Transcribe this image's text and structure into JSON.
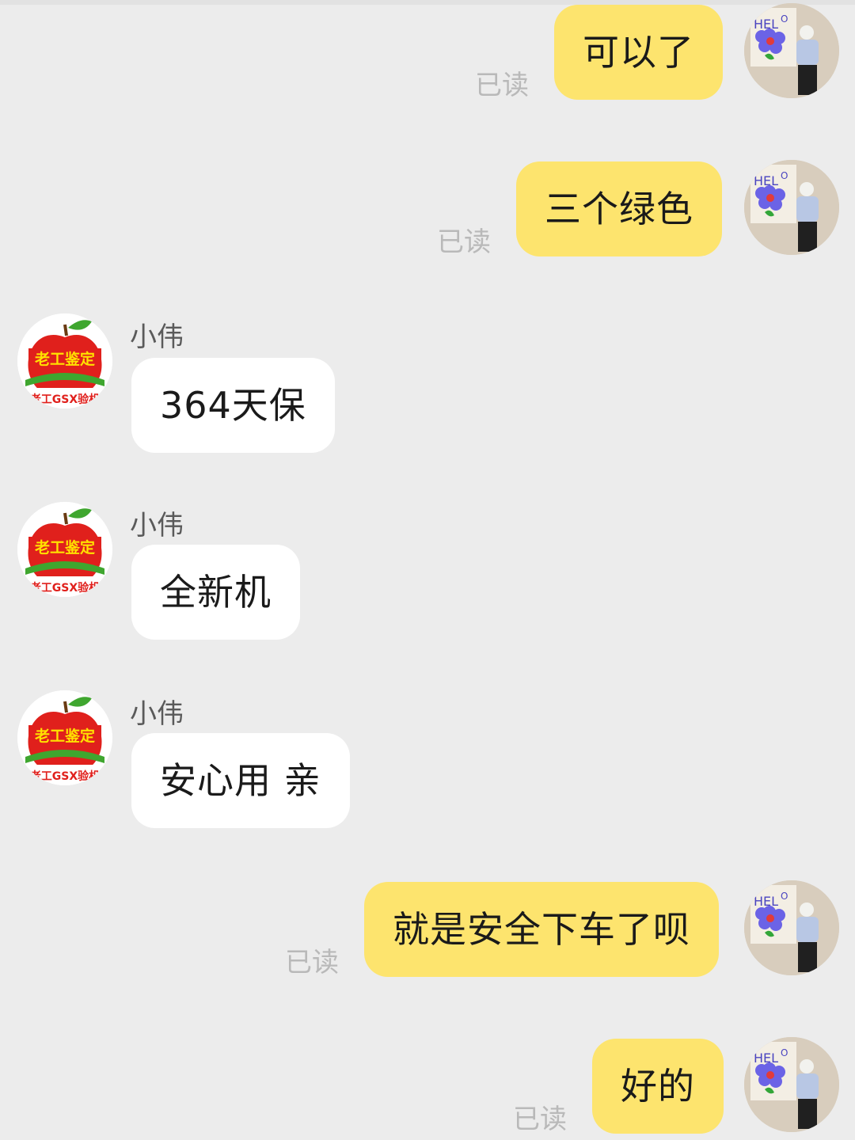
{
  "conversation": {
    "read_label": "已读",
    "messages": [
      {
        "id": "m1",
        "direction": "outgoing",
        "text": "可以了",
        "status": "已读"
      },
      {
        "id": "m2",
        "direction": "outgoing",
        "text": "三个绿色",
        "status": "已读"
      },
      {
        "id": "m3",
        "direction": "incoming",
        "sender": "小伟",
        "text": "364天保"
      },
      {
        "id": "m4",
        "direction": "incoming",
        "sender": "小伟",
        "text": "全新机"
      },
      {
        "id": "m5",
        "direction": "incoming",
        "sender": "小伟",
        "text": "安心用 亲"
      },
      {
        "id": "m6",
        "direction": "outgoing",
        "text": "就是安全下车了呗",
        "status": "已读"
      },
      {
        "id": "m7",
        "direction": "outgoing",
        "text": "好的",
        "status": "已读"
      }
    ]
  },
  "seller_avatar": {
    "icon": "apple-logo-icon",
    "brand_text": "老工鉴定",
    "sub_text": "老工GSX验机"
  },
  "user_avatar": {
    "icon": "hello-flower-photo-icon"
  },
  "colors": {
    "background": "#ececec",
    "outgoing_bubble": "#fde46e",
    "incoming_bubble": "#ffffff",
    "read_text": "#b9b9b9",
    "sender_text": "#5a5a5a",
    "avatar_apple_red": "#e0201c",
    "avatar_leaf_green": "#3fa62f",
    "avatar_text_yellow": "#ffe100"
  }
}
